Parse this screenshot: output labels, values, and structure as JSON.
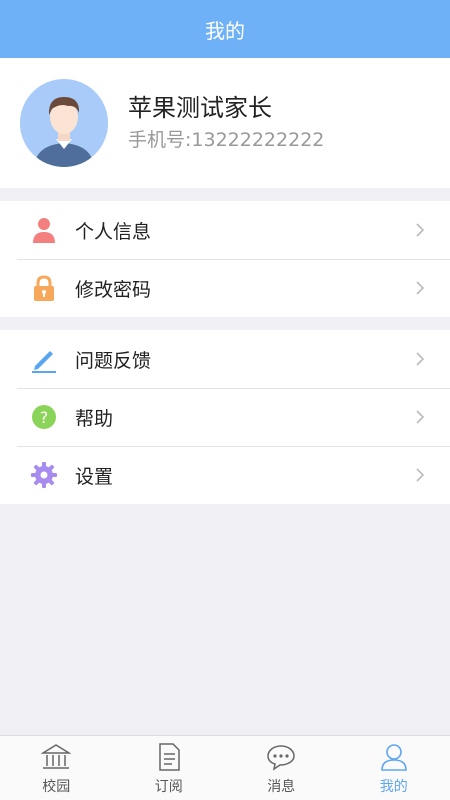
{
  "header": {
    "title": "我的"
  },
  "profile": {
    "name": "苹果测试家长",
    "phone": "手机号:13222222222",
    "avatar_icon": "user-avatar-icon"
  },
  "menu_group_1": [
    {
      "label": "个人信息",
      "icon": "person-icon",
      "color": "#f47f7f"
    },
    {
      "label": "修改密码",
      "icon": "lock-icon",
      "color": "#f8a85a"
    }
  ],
  "menu_group_2": [
    {
      "label": "问题反馈",
      "icon": "pencil-icon",
      "color": "#5aa5f2"
    },
    {
      "label": "帮助",
      "icon": "question-icon",
      "color": "#8bd45a"
    },
    {
      "label": "设置",
      "icon": "gear-icon",
      "color": "#a88bef"
    }
  ],
  "tabbar": {
    "items": [
      {
        "label": "校园",
        "icon": "campus-icon"
      },
      {
        "label": "订阅",
        "icon": "document-icon"
      },
      {
        "label": "消息",
        "icon": "chat-bubble-icon"
      },
      {
        "label": "我的",
        "icon": "user-icon",
        "active": true
      }
    ],
    "active_color": "#5fa6f2"
  },
  "colors": {
    "header_bg": "#6fb1f6",
    "page_bg": "#efeff4"
  }
}
